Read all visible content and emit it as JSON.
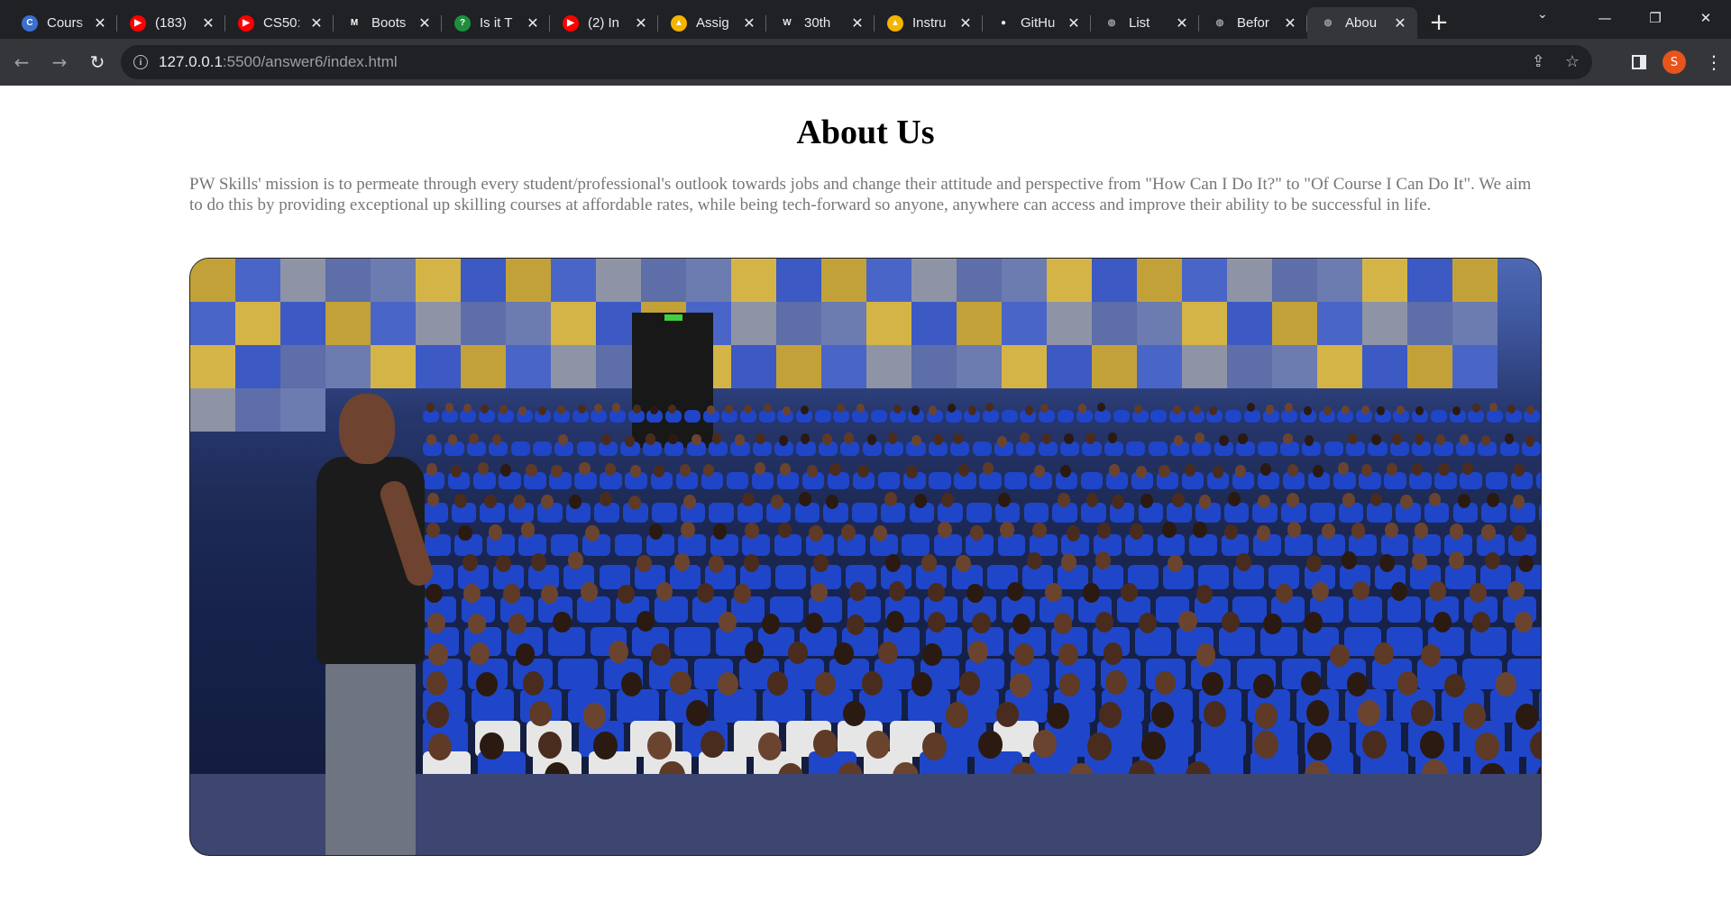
{
  "browser": {
    "tabs": [
      {
        "icon": "coursera-icon",
        "title": "Cours",
        "color": "#3b6fd1",
        "glyph": "C"
      },
      {
        "icon": "youtube-icon",
        "title": "(183)",
        "color": "#ff0000",
        "glyph": "▶"
      },
      {
        "icon": "youtube-icon",
        "title": "CS50:",
        "color": "#ff0000",
        "glyph": "▶"
      },
      {
        "icon": "mdn-icon",
        "title": "Boots",
        "color": "#202124",
        "glyph": "M"
      },
      {
        "icon": "quiz-icon",
        "title": "Is it T",
        "color": "#1e8e3e",
        "glyph": "?"
      },
      {
        "icon": "youtube-icon",
        "title": "(2) In",
        "color": "#ff0000",
        "glyph": "▶"
      },
      {
        "icon": "google-drive-icon",
        "title": "Assig",
        "color": "#f4b400",
        "glyph": "▲"
      },
      {
        "icon": "wikipedia-icon",
        "title": "30th",
        "color": "#e8eaed",
        "glyph": "W"
      },
      {
        "icon": "google-drive-icon",
        "title": "Instru",
        "color": "#f4b400",
        "glyph": "▲"
      },
      {
        "icon": "github-icon",
        "title": "GitHu",
        "color": "#e8eaed",
        "glyph": "●"
      },
      {
        "icon": "globe-icon",
        "title": "List",
        "color": "#9aa0a6",
        "glyph": "◍"
      },
      {
        "icon": "globe-icon",
        "title": "Befor",
        "color": "#9aa0a6",
        "glyph": "◍"
      },
      {
        "icon": "globe-icon",
        "title": "Abou",
        "color": "#9aa0a6",
        "glyph": "◍",
        "active": true
      }
    ],
    "url_host": "127.0.0.1",
    "url_rest": ":5500/answer6/index.html",
    "profile_initial": "S"
  },
  "page": {
    "heading": "About Us",
    "mission": "PW Skills' mission is to permeate through every student/professional's outlook towards jobs and change their attitude and perspective from \"How Can I Do It?\" to \"Of Course I Can Do It\". We aim to do this by providing exceptional up skilling courses at affordable rates, while being tech-forward so anyone, anywhere can access and improve their ability to be successful in life."
  }
}
